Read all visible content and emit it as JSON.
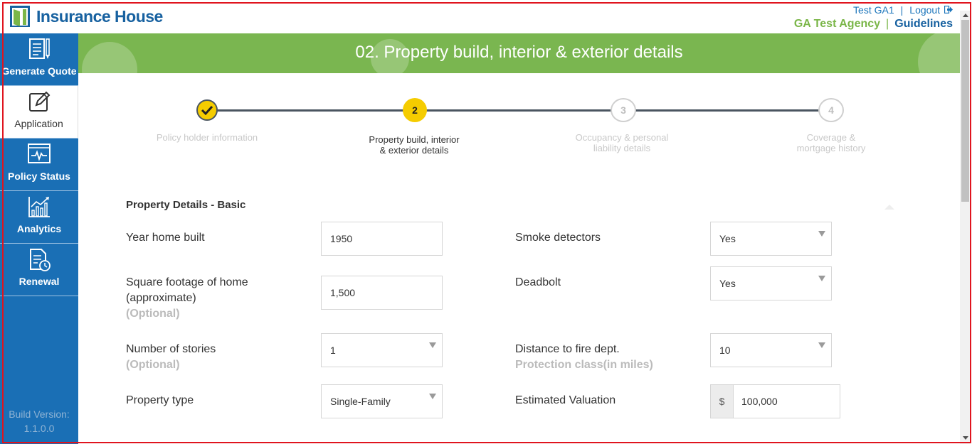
{
  "brand": {
    "name": "Insurance House"
  },
  "header": {
    "user": "Test GA1",
    "separator": "|",
    "logout": "Logout",
    "agency": "GA Test Agency",
    "guidelines": "Guidelines"
  },
  "sidebar": {
    "items": [
      {
        "label": "Generate Quote",
        "icon": "document-pen-icon"
      },
      {
        "label": "Application",
        "icon": "edit-icon"
      },
      {
        "label": "Policy Status",
        "icon": "pulse-monitor-icon"
      },
      {
        "label": "Analytics",
        "icon": "bar-chart-icon"
      },
      {
        "label": "Renewal",
        "icon": "document-clock-icon"
      }
    ],
    "build_label": "Build Version:",
    "build_number": "1.1.0.0"
  },
  "banner": {
    "title": "02. Property build, interior & exterior details"
  },
  "stepper": {
    "steps": [
      {
        "mark": "✓",
        "label1": "Policy holder information",
        "label2": ""
      },
      {
        "mark": "2",
        "label1": "Property build, interior",
        "label2": "& exterior details"
      },
      {
        "mark": "3",
        "label1": "Occupancy & personal",
        "label2": "liability details"
      },
      {
        "mark": "4",
        "label1": "Coverage &",
        "label2": "mortgage history"
      }
    ]
  },
  "form": {
    "section_title": "Property Details - Basic",
    "year_built": {
      "label": "Year home built",
      "value": "1950"
    },
    "square_footage": {
      "label1": "Square footage of home",
      "label2": "(approximate)",
      "optional": "(Optional)",
      "value": "1,500"
    },
    "stories": {
      "label": "Number of stories",
      "optional": "(Optional)",
      "value": "1"
    },
    "property_type": {
      "label": "Property type",
      "value": "Single-Family"
    },
    "smoke_detectors": {
      "label": "Smoke detectors",
      "value": "Yes"
    },
    "deadbolt": {
      "label": "Deadbolt",
      "value": "Yes"
    },
    "fire_dept": {
      "label": "Distance to fire dept.",
      "sublabel": "Protection class(in miles)",
      "value": "10"
    },
    "valuation": {
      "label": "Estimated Valuation",
      "currency": "$",
      "value": "100,000"
    }
  },
  "colors": {
    "brand_blue": "#1a6fb5",
    "banner_green": "#7ab650",
    "agency_green": "#7ab648",
    "step_yellow": "#f5cc00",
    "frame_red": "#e0141e"
  }
}
